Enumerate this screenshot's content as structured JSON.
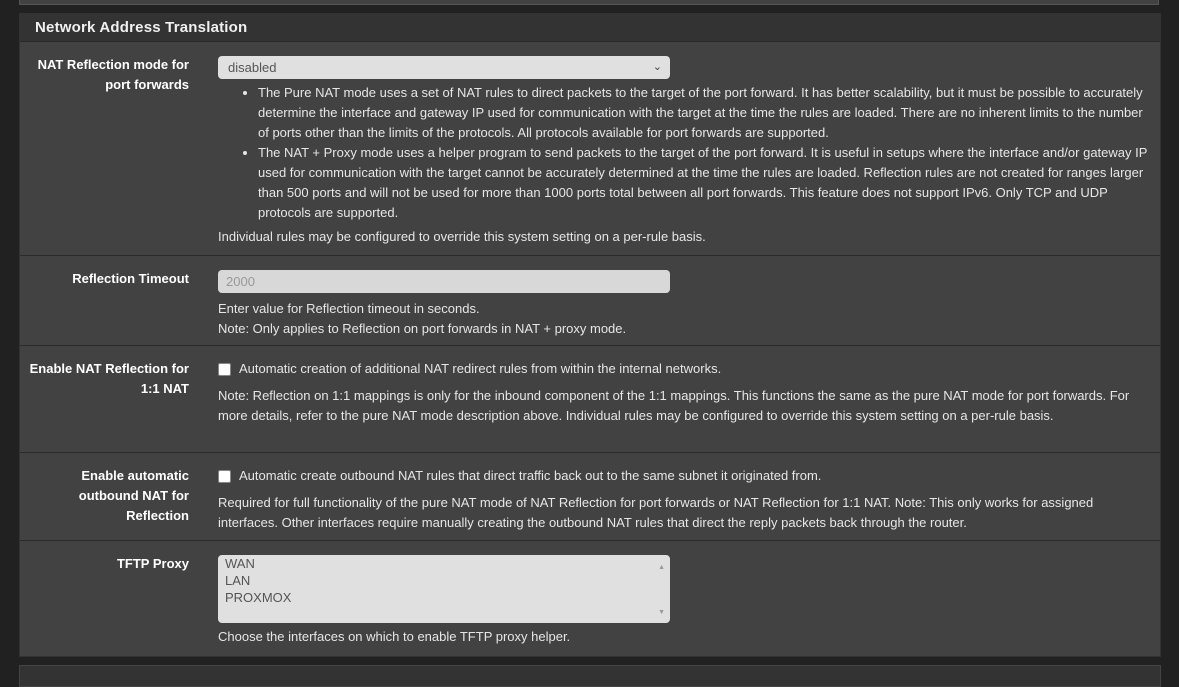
{
  "panel": {
    "title": "Network Address Translation"
  },
  "rows": {
    "reflection_mode": {
      "label": "NAT Reflection mode for port forwards",
      "value": "disabled",
      "bullets": [
        "The Pure NAT mode uses a set of NAT rules to direct packets to the target of the port forward. It has better scalability, but it must be possible to accurately determine the interface and gateway IP used for communication with the target at the time the rules are loaded. There are no inherent limits to the number of ports other than the limits of the protocols. All protocols available for port forwards are supported.",
        "The NAT + Proxy mode uses a helper program to send packets to the target of the port forward. It is useful in setups where the interface and/or gateway IP used for communication with the target cannot be accurately determined at the time the rules are loaded. Reflection rules are not created for ranges larger than 500 ports and will not be used for more than 1000 ports total between all port forwards. This feature does not support IPv6. Only TCP and UDP protocols are supported."
      ],
      "note": "Individual rules may be configured to override this system setting on a per-rule basis."
    },
    "reflection_timeout": {
      "label": "Reflection Timeout",
      "placeholder": "2000",
      "help1": "Enter value for Reflection timeout in seconds.",
      "help2": "Note: Only applies to Reflection on port forwards in NAT + proxy mode."
    },
    "reflection_1to1": {
      "label": "Enable NAT Reflection for 1:1 NAT",
      "checkbox_label": "Automatic creation of additional NAT redirect rules from within the internal networks.",
      "checked": false,
      "help": "Note: Reflection on 1:1 mappings is only for the inbound component of the 1:1 mappings. This functions the same as the pure NAT mode for port forwards. For more details, refer to the pure NAT mode description above. Individual rules may be configured to override this system setting on a per-rule basis."
    },
    "auto_outbound": {
      "label": "Enable automatic outbound NAT for Reflection",
      "checkbox_label": "Automatic create outbound NAT rules that direct traffic back out to the same subnet it originated from.",
      "checked": false,
      "help": "Required for full functionality of the pure NAT mode of NAT Reflection for port forwards or NAT Reflection for 1:1 NAT. Note: This only works for assigned interfaces. Other interfaces require manually creating the outbound NAT rules that direct the reply packets back through the router."
    },
    "tftp_proxy": {
      "label": "TFTP Proxy",
      "options": [
        "WAN",
        "LAN",
        "PROXMOX"
      ],
      "help": "Choose the interfaces on which to enable TFTP proxy helper."
    }
  }
}
